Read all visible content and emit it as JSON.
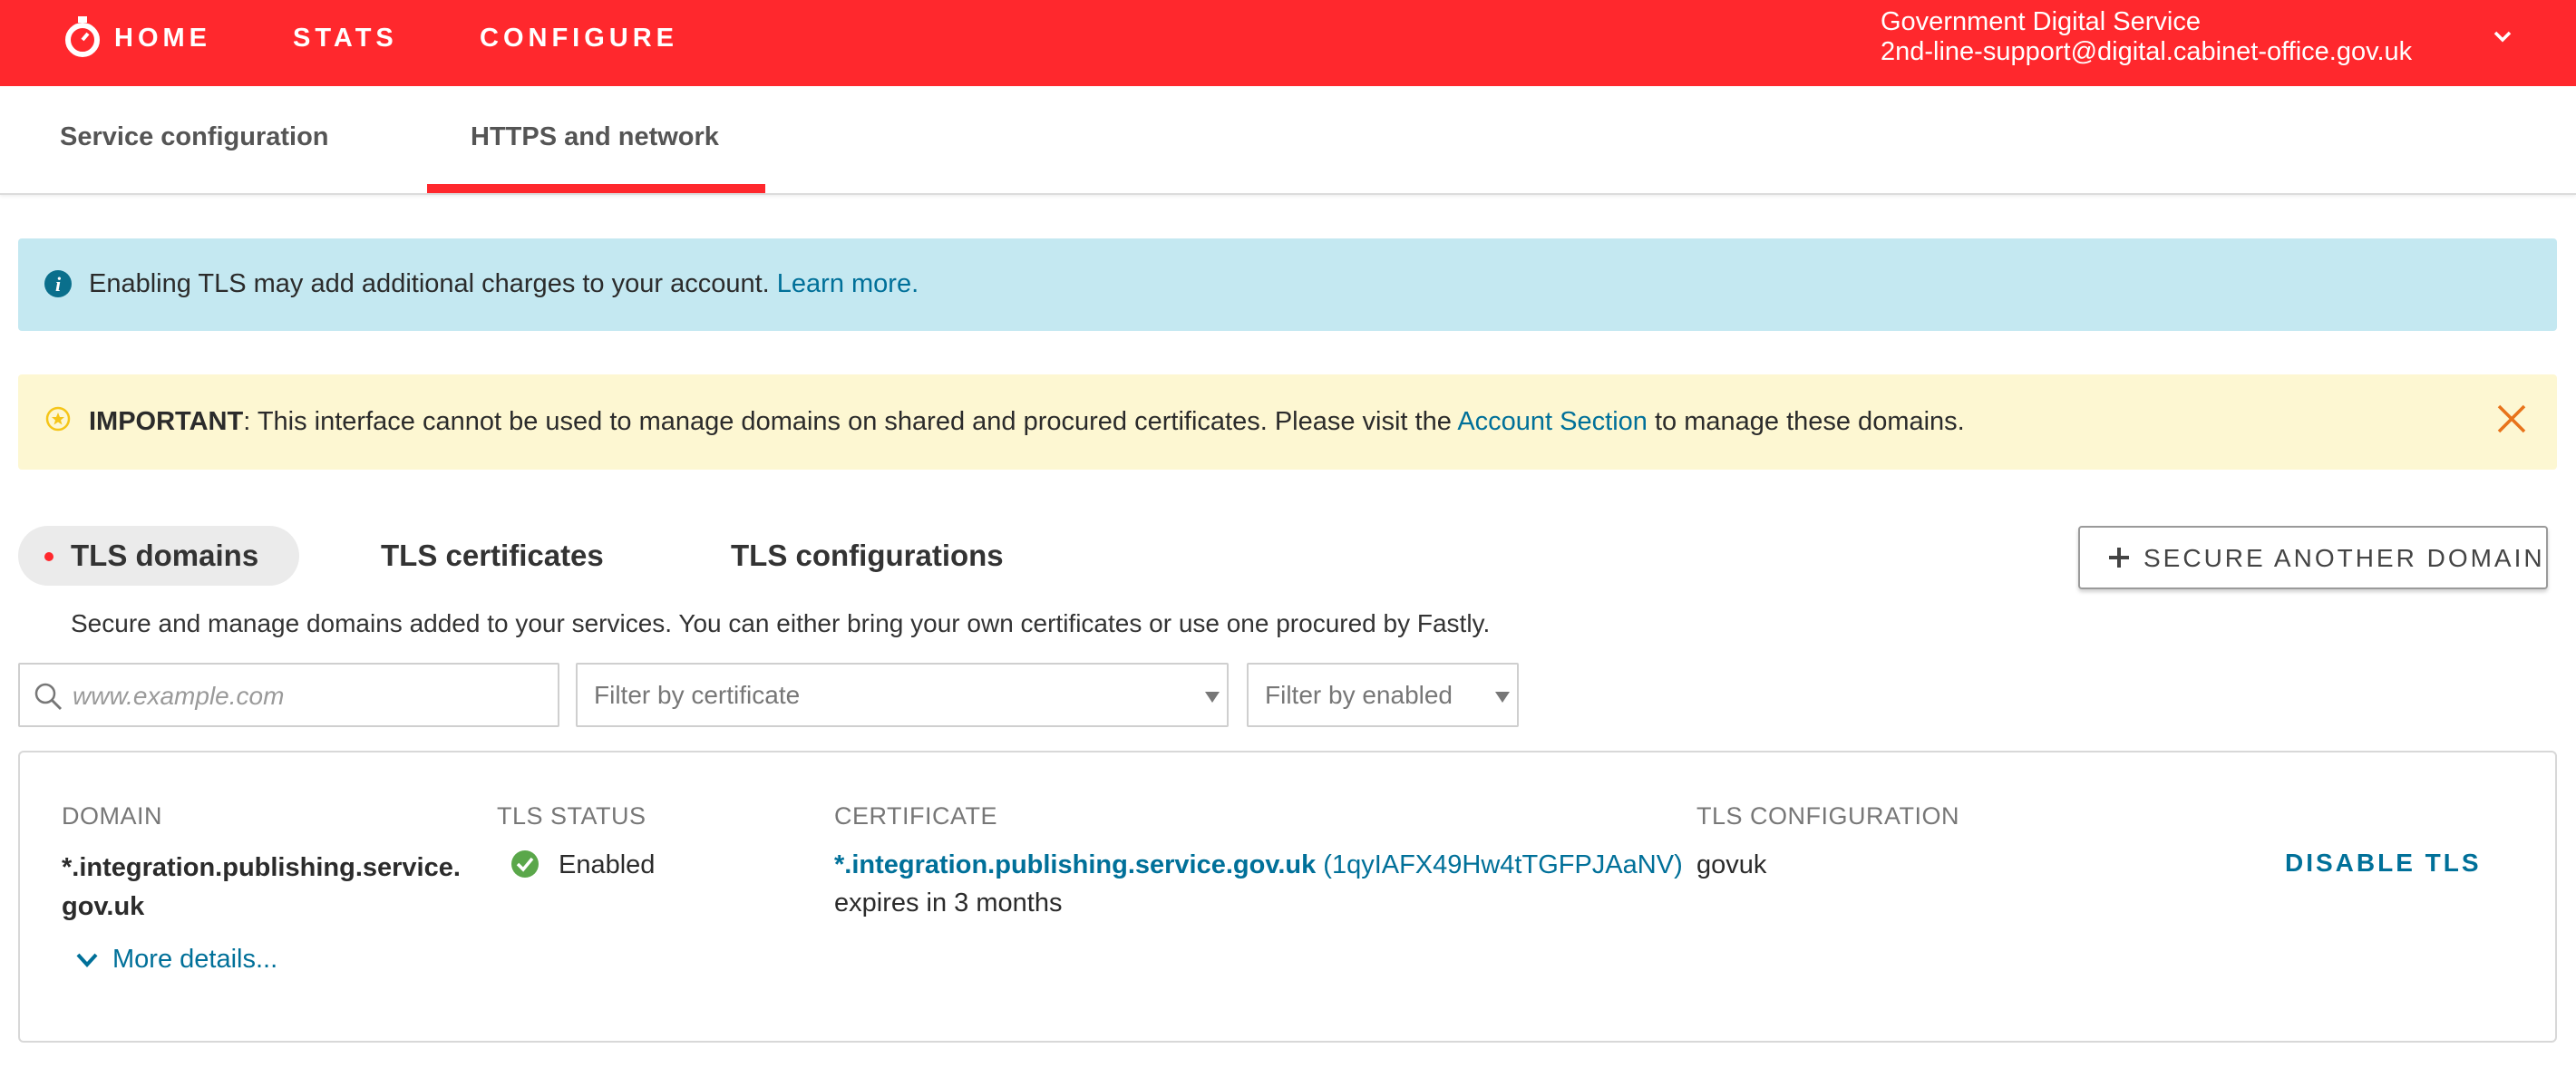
{
  "topnav": {
    "items": [
      "HOME",
      "STATS",
      "CONFIGURE"
    ],
    "account_org": "Government Digital Service",
    "account_email": "2nd-line-support@digital.cabinet-office.gov.uk",
    "brand_color": "#ff282d"
  },
  "subtabs": {
    "items": [
      "Service configuration",
      "HTTPS and network"
    ],
    "active": "HTTPS and network"
  },
  "info_banner": {
    "text": "Enabling TLS may add additional charges to your account.",
    "link": "Learn more.",
    "icon": "info-icon"
  },
  "warning_banner": {
    "bold": "IMPORTANT",
    "text_before": ": This interface cannot be used to manage domains on shared and procured certificates. Please visit the ",
    "link": "Account Section",
    "text_after": " to manage these domains.",
    "icon": "star-icon"
  },
  "section_tabs": {
    "items": [
      "TLS domains",
      "TLS certificates",
      "TLS configurations"
    ],
    "active": "TLS domains",
    "description": "Secure and manage domains added to your services. You can either bring your own certificates or use one procured by Fastly."
  },
  "secure_button": {
    "label": "SECURE ANOTHER DOMAIN"
  },
  "filters": {
    "search_placeholder": "www.example.com",
    "certificate_placeholder": "Filter by certificate",
    "enabled_placeholder": "Filter by enabled"
  },
  "domains_table": {
    "columns": [
      "DOMAIN",
      "TLS STATUS",
      "CERTIFICATE",
      "TLS CONFIGURATION"
    ],
    "rows": [
      {
        "domain": "*.integration.publishing.service.gov.uk",
        "status": "Enabled",
        "certificate_name": "*.integration.publishing.service.gov.uk",
        "certificate_id": "(1qyIAFX49Hw4tTGFPJAaNV)",
        "certificate_expiry": "expires in 3 months",
        "configuration": "govuk",
        "action": "DISABLE TLS",
        "more": "More details..."
      }
    ]
  }
}
